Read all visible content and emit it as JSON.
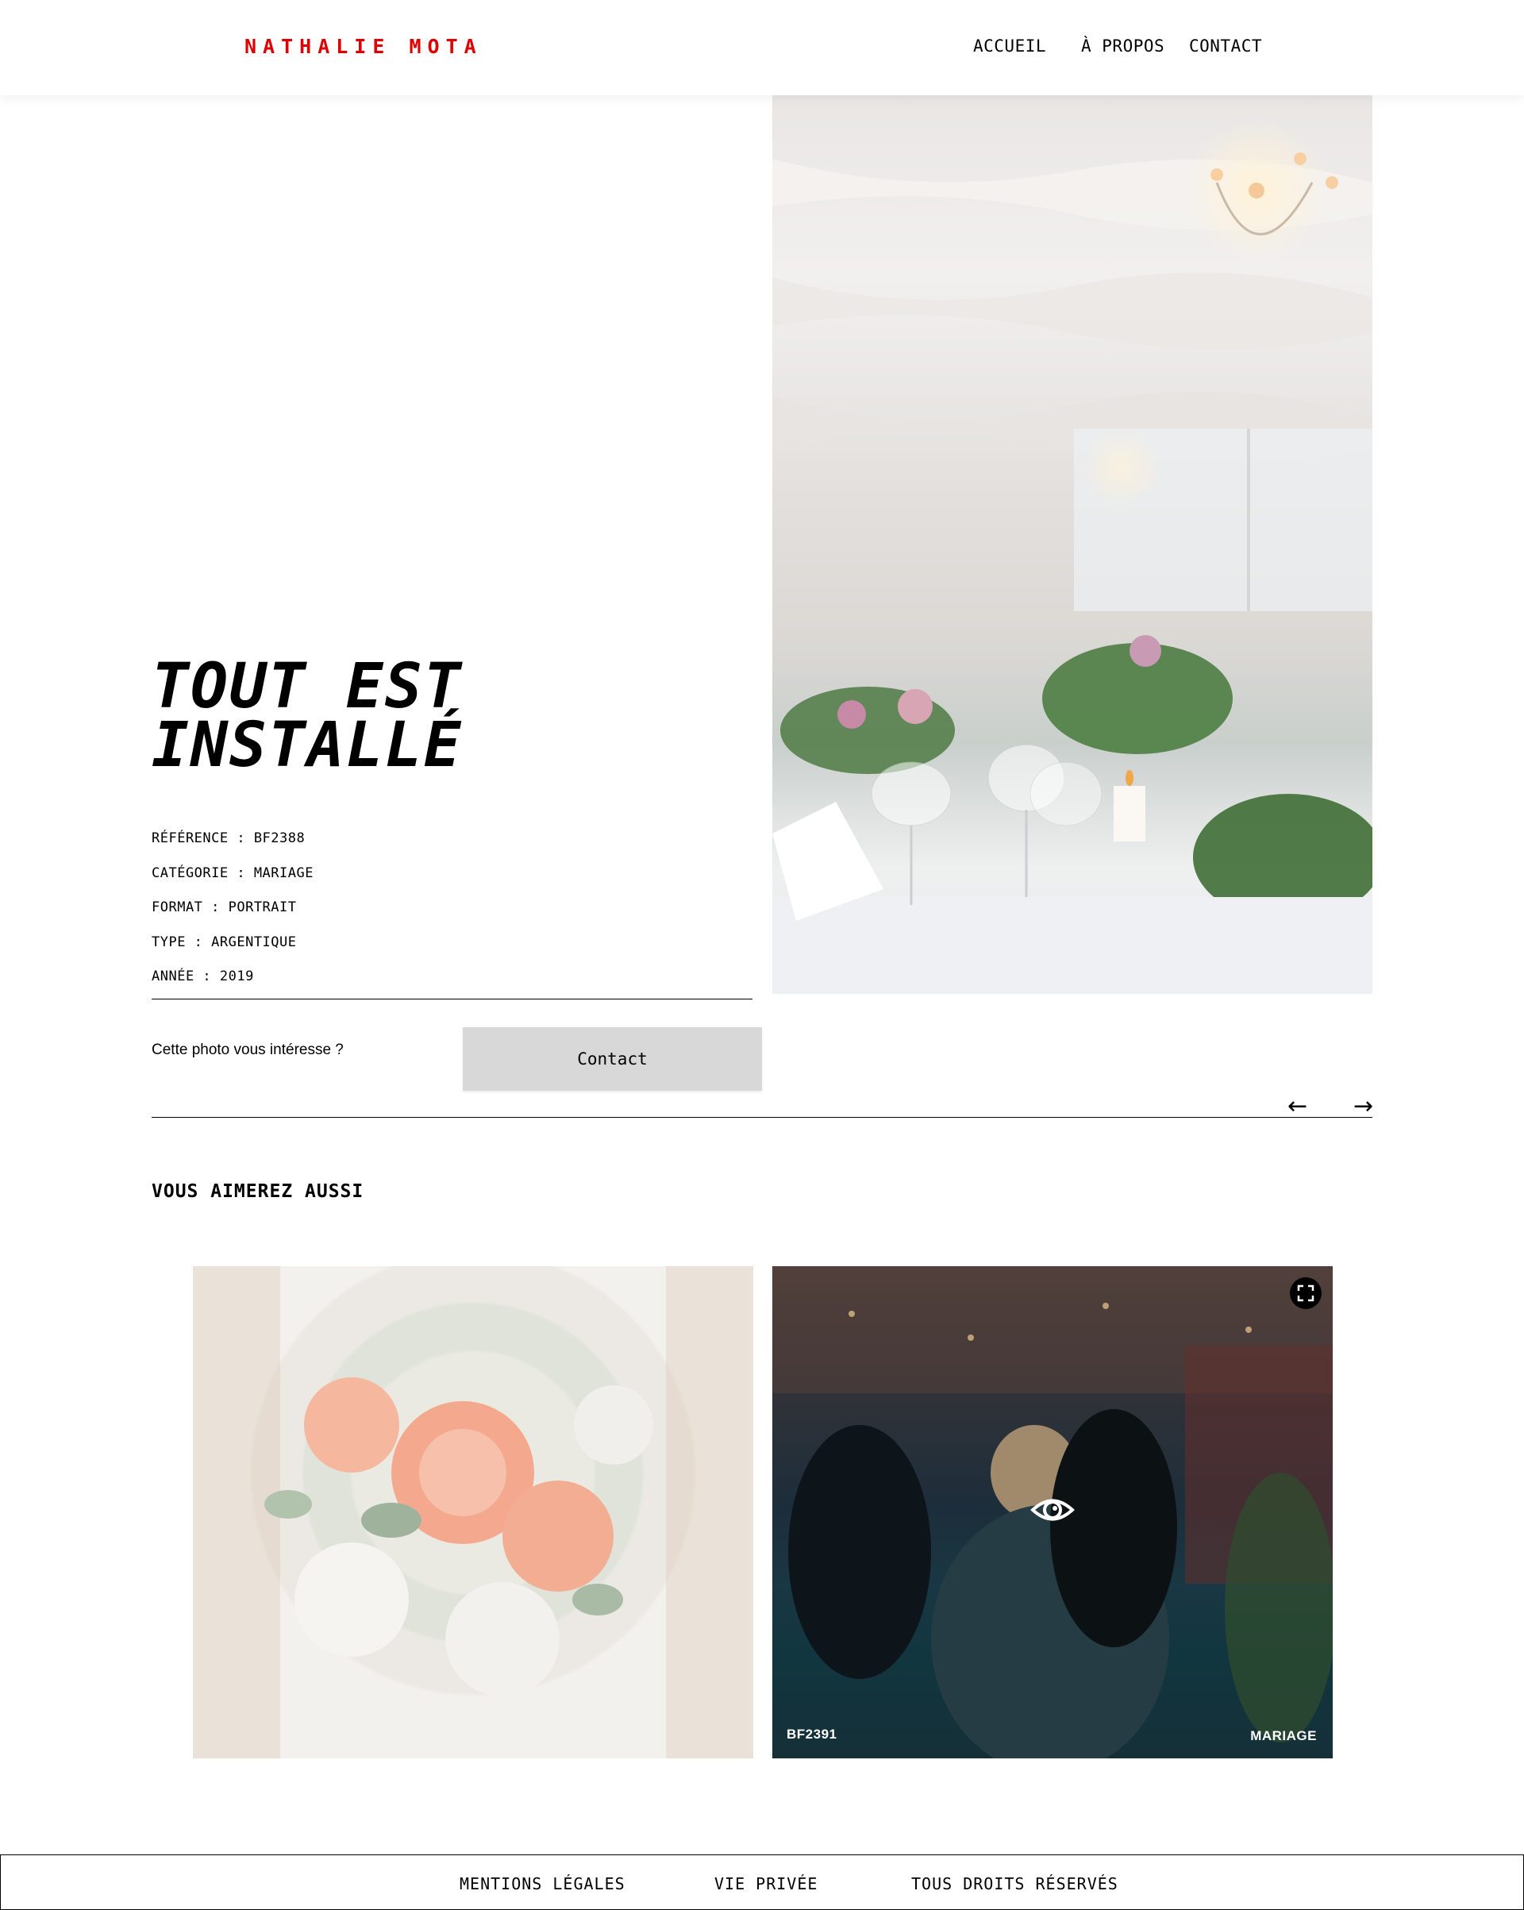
{
  "header": {
    "logo": "NATHALIE MOTA",
    "nav": [
      "ACCUEIL",
      "À PROPOS",
      "CONTACT"
    ]
  },
  "photo": {
    "title_line1": "TOUT EST",
    "title_line2": "INSTALLÉ",
    "meta": [
      "RÉFÉRENCE : BF2388",
      "CATÉGORIE : MARIAGE",
      "FORMAT : PORTRAIT",
      "TYPE : ARGENTIQUE",
      "ANNÉE : 2019"
    ],
    "interest_text": "Cette photo vous intéresse ?",
    "contact_label": "Contact",
    "prev_icon": "←",
    "next_icon": "→"
  },
  "related": {
    "title": "VOUS AIMEREZ AUSSI",
    "cards": [
      {
        "image": "bridal-bouquet-photo"
      },
      {
        "image": "wedding-dance-photo",
        "reference": "BF2391",
        "category": "MARIAGE",
        "fullscreen_icon": "fullscreen-icon",
        "eye_icon": "eye-icon"
      }
    ]
  },
  "footer": {
    "links": [
      "MENTIONS LÉGALES",
      "VIE PRIVÉE",
      "TOUS DROITS RÉSERVÉS"
    ]
  },
  "colors": {
    "brand": "#e00000",
    "button_bg": "#d8d8d8"
  }
}
